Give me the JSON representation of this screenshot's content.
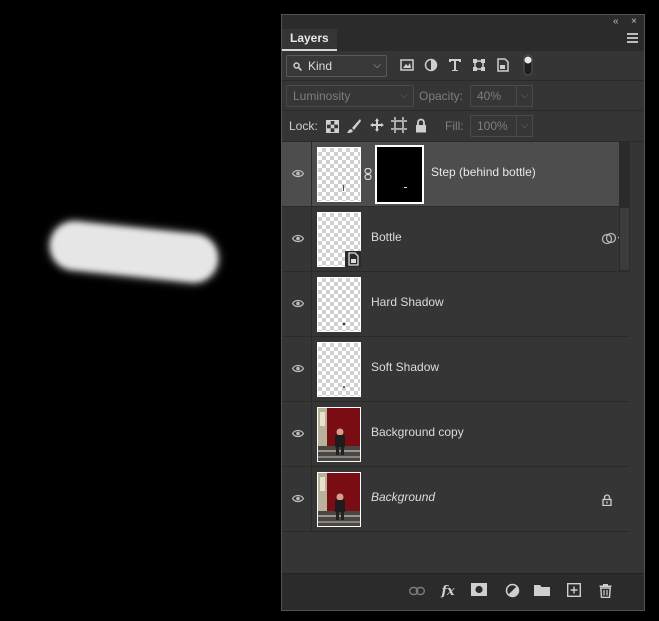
{
  "panel": {
    "tab_label": "Layers",
    "collapse_glyph": "«",
    "close_glyph": "×"
  },
  "filter": {
    "kind_value": "Kind",
    "icons": [
      "image-filter-icon",
      "adjustment-filter-icon",
      "type-filter-icon",
      "shape-filter-icon",
      "smart-object-filter-icon",
      "filter-toggle-icon"
    ]
  },
  "blend": {
    "mode": "Luminosity",
    "opacity_label": "Opacity:",
    "opacity_value": "40%"
  },
  "lock": {
    "label": "Lock:",
    "fill_label": "Fill:",
    "fill_value": "100%",
    "icons": [
      "lock-transparent-pixels-icon",
      "lock-image-pixels-icon",
      "lock-position-icon",
      "lock-artboard-icon",
      "lock-all-icon"
    ]
  },
  "layers": [
    {
      "name": "Step (behind bottle)",
      "selected": true,
      "has_mask": true,
      "thumb": "transparent"
    },
    {
      "name": "Bottle",
      "selected": false,
      "smart_object": true,
      "thumb": "transparent"
    },
    {
      "name": "Hard Shadow",
      "selected": false,
      "thumb": "transparent"
    },
    {
      "name": "Soft Shadow",
      "selected": false,
      "thumb": "transparent"
    },
    {
      "name": "Background copy",
      "selected": false,
      "thumb": "photo"
    },
    {
      "name": "Background",
      "selected": false,
      "thumb": "photo",
      "locked": true,
      "italic": true
    }
  ],
  "bottom_toolbar": {
    "fx_label": "fx",
    "icons": [
      "link-layers-icon",
      "layer-style-icon",
      "add-mask-icon",
      "adjustment-layer-icon",
      "group-icon",
      "new-layer-icon",
      "delete-layer-icon"
    ]
  }
}
